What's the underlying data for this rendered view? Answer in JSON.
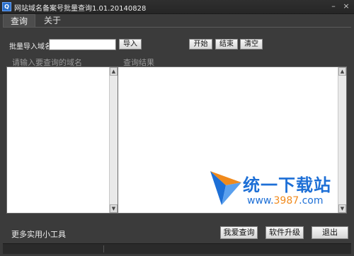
{
  "window": {
    "title": "网站域名备案号批量查询1.01.20140828",
    "icon": "app-icon",
    "icon_glyph": "Q",
    "minimize_glyph": "–",
    "close_glyph": "×"
  },
  "tabs": [
    {
      "label": "查询",
      "active": true
    },
    {
      "label": "关于",
      "active": false
    }
  ],
  "controls": {
    "import_label": "批量导入域名",
    "import_value": "",
    "import_button": "导入",
    "start_button": "开始",
    "stop_button": "结束",
    "clear_button": "清空"
  },
  "panels": {
    "input_header": "请输入要查询的域名",
    "result_header": "查询结果",
    "scroll_up_glyph": "▲",
    "scroll_down_glyph": "▼"
  },
  "watermark": {
    "logo_text": "统一下载站",
    "url_prefix": "www.",
    "url_number": "3987",
    "url_suffix": ".com"
  },
  "footer": {
    "more_tools": "更多实用小工具",
    "love_button": "我爱查询",
    "upgrade_button": "软件升级",
    "exit_button": "退出"
  },
  "colors": {
    "window_bg": "#3b3b3b",
    "watermark_blue": "#1d6fd6",
    "watermark_orange": "#f08a1c"
  }
}
